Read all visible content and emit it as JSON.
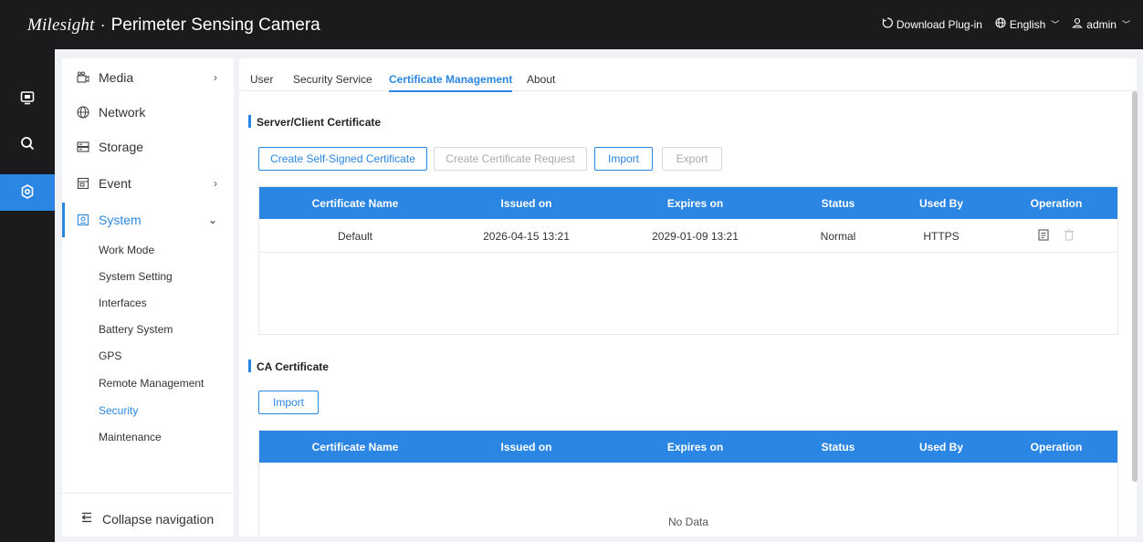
{
  "header": {
    "brand": "Milesight",
    "separator": "·",
    "title": "Perimeter Sensing Camera",
    "download_plugin": "Download Plug-in",
    "language": "English",
    "user": "admin"
  },
  "rail": {
    "icons": [
      "monitor-icon",
      "search-icon",
      "settings-icon"
    ],
    "active": "settings"
  },
  "nav": {
    "items": [
      {
        "label": "Media",
        "icon": "media-icon",
        "has_arrow": true
      },
      {
        "label": "Network",
        "icon": "globe-icon",
        "has_arrow": false
      },
      {
        "label": "Storage",
        "icon": "storage-icon",
        "has_arrow": false
      },
      {
        "label": "Event",
        "icon": "event-icon",
        "has_arrow": true
      },
      {
        "label": "System",
        "icon": "system-icon",
        "has_arrow": true
      }
    ],
    "system_sub": [
      "Work Mode",
      "System Setting",
      "Interfaces",
      "Battery System",
      "GPS",
      "Remote Management",
      "Security",
      "Maintenance"
    ],
    "active_sub": "Security",
    "collapse_label": "Collapse navigation"
  },
  "tabs": [
    "User",
    "Security Service",
    "Certificate Management",
    "About"
  ],
  "active_tab": "Certificate Management",
  "server_section": {
    "title": "Server/Client Certificate",
    "buttons": {
      "create_self_signed": "Create Self-Signed Certificate",
      "create_request": "Create Certificate Request",
      "import": "Import",
      "export": "Export"
    },
    "columns": [
      "Certificate Name",
      "Issued on",
      "Expires on",
      "Status",
      "Used By",
      "Operation"
    ],
    "rows": [
      {
        "name": "Default",
        "issued": "2026-04-15 13:21",
        "expires": "2029-01-09 13:21",
        "status": "Normal",
        "used_by": "HTTPS"
      }
    ]
  },
  "ca_section": {
    "title": "CA Certificate",
    "buttons": {
      "import": "Import"
    },
    "columns": [
      "Certificate Name",
      "Issued on",
      "Expires on",
      "Status",
      "Used By",
      "Operation"
    ],
    "empty_text": "No Data"
  },
  "colors": {
    "accent": "#2b86e3",
    "topbar": "#1b1b1d",
    "background": "#f0f2f5"
  }
}
